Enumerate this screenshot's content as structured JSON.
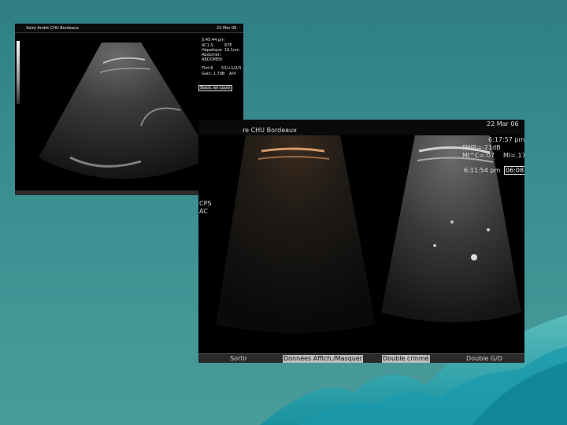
{
  "scan1": {
    "header_left": "Saint André CHU Bordeaux",
    "date": "22 Mar 06",
    "time": "5:45:44 pm",
    "params": [
      "4C1-S",
      "Hépatique",
      "Abdomen",
      "ABDOMEN"
    ],
    "params_right": [
      "67Ε",
      "16.1cm"
    ],
    "params2": [
      "Thrl:6",
      "Gain: 1.7dB"
    ],
    "params2_right": [
      "53/+1/2/3",
      "A/4"
    ],
    "stock_label": "Stock. en cours"
  },
  "scan2": {
    "header_left": "re CHU Bordeaux",
    "date": "22 Mar 06",
    "time": "6:17:57 pm",
    "pwr": "PWR=-21dB",
    "mic": "MI^C=.07",
    "mi": "MI=.17",
    "time2": "6:11:54 pm",
    "time2_box": "06:08",
    "side_labels": [
      "CPS",
      "AC"
    ],
    "buttons": [
      "Sortir",
      "Données Affich./Masquer",
      "Double crinmé",
      "Double G/D"
    ]
  }
}
